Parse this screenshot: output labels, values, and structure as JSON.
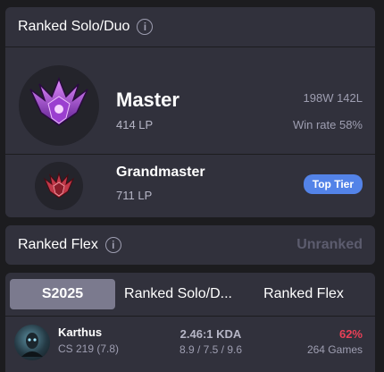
{
  "solo": {
    "title": "Ranked Solo/Duo",
    "info_icon": "i",
    "current": {
      "tier": "Master",
      "lp": "414 LP",
      "record": "198W 142L",
      "winrate": "Win rate 58%"
    },
    "peak": {
      "tier": "Grandmaster",
      "lp": "711 LP",
      "badge": "Top Tier"
    }
  },
  "flex": {
    "title": "Ranked Flex",
    "info_icon": "i",
    "status": "Unranked"
  },
  "tabs": [
    "S2025",
    "Ranked Solo/D...",
    "Ranked Flex"
  ],
  "champions": [
    {
      "name": "Karthus",
      "cs": "CS 219 (7.8)",
      "kda": "2.46:1 KDA",
      "kda_detail": "8.9 / 7.5 / 9.6",
      "winrate": "62%",
      "games": "264 Games"
    }
  ],
  "colors": {
    "accent": "#5383e8",
    "loss": "#e84057",
    "card": "#31313c",
    "background": "#1c1c1f"
  }
}
